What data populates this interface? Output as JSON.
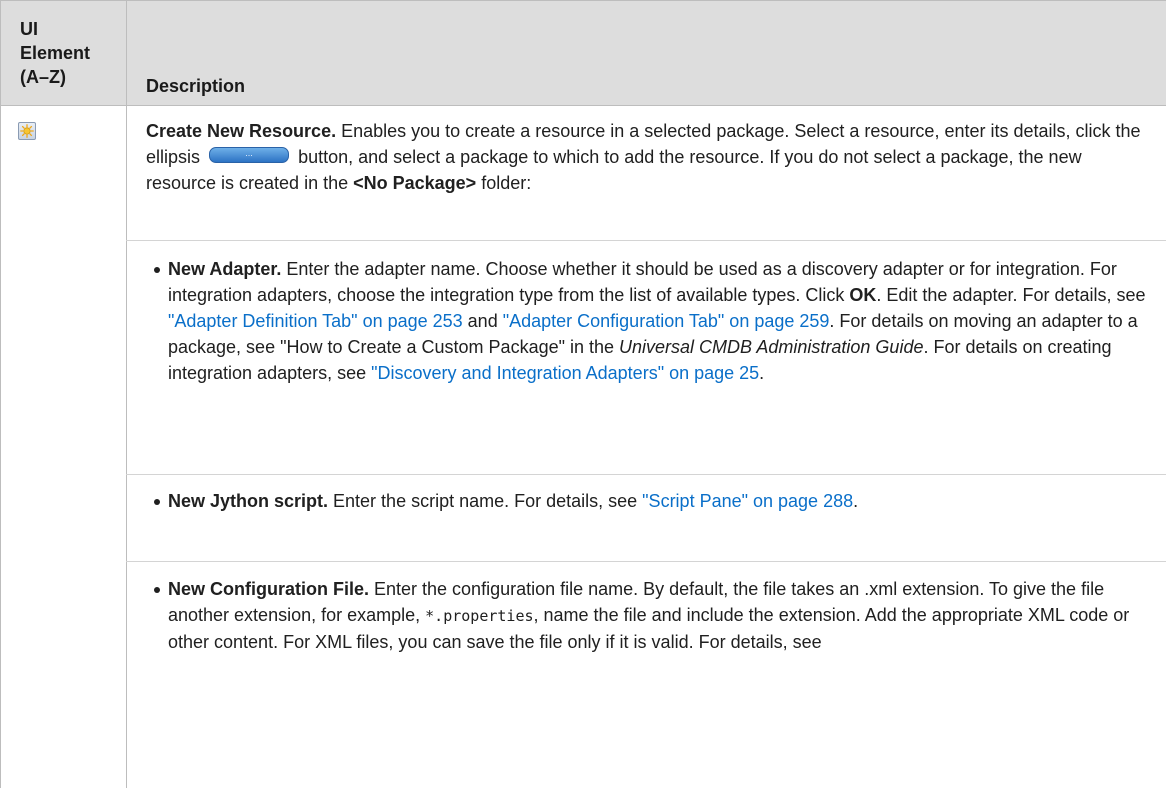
{
  "header": {
    "col1_lines": [
      "UI",
      "Element",
      "(A–Z)"
    ],
    "col2": "Description"
  },
  "row": {
    "icon": "create-new-resource-icon",
    "title": "Create New Resource.",
    "text1": " Enables you to create a resource in a selected package. Select a resource, enter its details, click the ellipsis",
    "button_label": "...",
    "text2": "button, and select a package to which to add the resource. If you do not select a package, the new resource is created in the ",
    "folder": "<No Package>",
    "text3": " folder:"
  },
  "bullets": {
    "adapter": {
      "title": "New Adapter.",
      "t1": " Enter the adapter name. Choose whether it should be used as a discovery adapter or for integration. For integration adapters, choose the integration type from the list of available types. Click ",
      "ok": "OK",
      "t2": ". Edit the adapter. For details, see ",
      "link1": "\"Adapter Definition Tab\" on page 253",
      "t3": " and ",
      "link2": "\"Adapter Configuration Tab\" on page 259",
      "t4": ". For details on moving an adapter to a package, see \"How to Create a Custom Package\" in the ",
      "guide": "Universal CMDB Administration Guide",
      "t5": ". For details on creating integration adapters, see ",
      "link3": "\"Discovery and Integration Adapters\" on page 25",
      "t6": "."
    },
    "jython": {
      "title": "New Jython script.",
      "t1": " Enter the script name. For details, see ",
      "link": "\"Script Pane\" on page 288",
      "t2": "."
    },
    "config": {
      "title": "New Configuration File.",
      "t1": " Enter the configuration file name. By default, the file takes an .xml extension. To give the file another extension, for example, ",
      "code": "*.properties",
      "t2": ", name the file and include the extension. Add the appropriate XML code or other content. For XML files, you can save the file only if it is valid. For details, see"
    }
  },
  "colors": {
    "link": "#0a6fc9",
    "header_bg": "#dddddd",
    "border": "#bdbdbd"
  }
}
